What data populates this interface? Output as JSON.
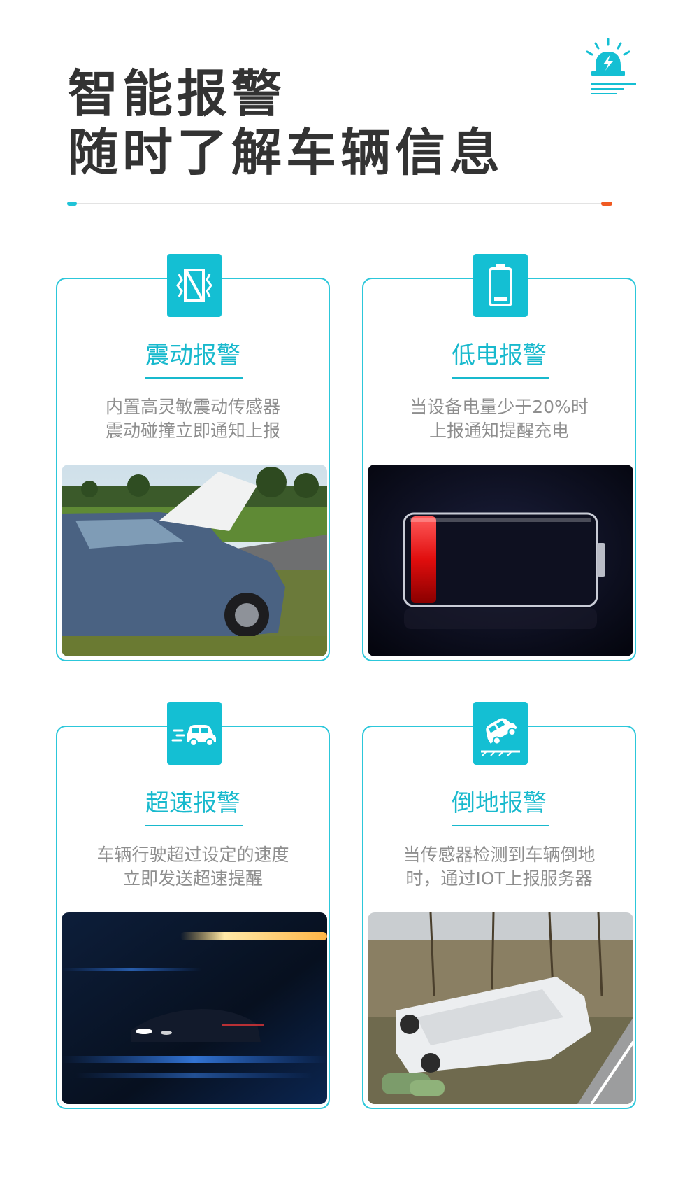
{
  "header": {
    "title_line1": "智能报警",
    "title_line2": "随时了解车辆信息",
    "icon": "alarm-light-icon"
  },
  "colors": {
    "accent": "#14bfd3",
    "accent_text": "#18b9cd",
    "border": "#2cc7da",
    "title_text": "#333333",
    "desc_text": "#8e8e8e",
    "divider_left_cap": "#20c3d7",
    "divider_right_cap": "#f05a22"
  },
  "cards": [
    {
      "title": "震动报警",
      "icon": "vibration-icon",
      "desc": [
        "内置高灵敏震动传感器",
        "震动碰撞立即通知上报"
      ],
      "photo": "car-with-open-hood-photo"
    },
    {
      "title": "低电报警",
      "icon": "battery-icon",
      "desc": [
        "当设备电量少于20%时",
        "上报通知提醒充电"
      ],
      "photo": "low-battery-photo"
    },
    {
      "title": "超速报警",
      "icon": "speeding-car-icon",
      "desc": [
        "车辆行驶超过设定的速度",
        "立即发送超速提醒"
      ],
      "photo": "night-speeding-car-photo"
    },
    {
      "title": "倒地报警",
      "icon": "overturned-car-icon",
      "desc": [
        "当传感器检测到车辆倒地",
        "时，通过IOT上报服务器"
      ],
      "photo": "overturned-vehicle-photo"
    }
  ]
}
